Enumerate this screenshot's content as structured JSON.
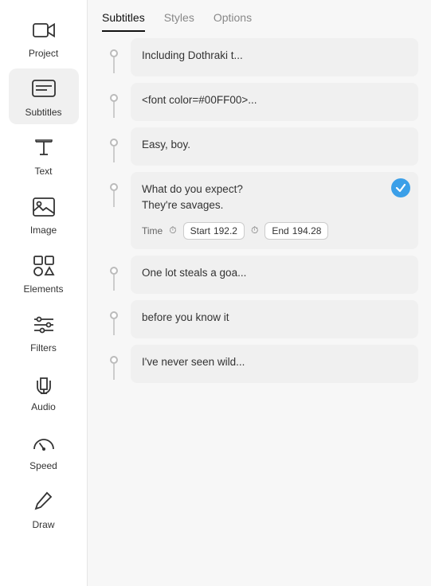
{
  "sidebar": {
    "items": [
      {
        "id": "project",
        "label": "Project",
        "icon": "video-icon"
      },
      {
        "id": "subtitles",
        "label": "Subtitles",
        "icon": "subtitles-icon",
        "active": true
      },
      {
        "id": "text",
        "label": "Text",
        "icon": "text-icon"
      },
      {
        "id": "image",
        "label": "Image",
        "icon": "image-icon"
      },
      {
        "id": "elements",
        "label": "Elements",
        "icon": "elements-icon"
      },
      {
        "id": "filters",
        "label": "Filters",
        "icon": "filters-icon"
      },
      {
        "id": "audio",
        "label": "Audio",
        "icon": "audio-icon"
      },
      {
        "id": "speed",
        "label": "Speed",
        "icon": "speed-icon"
      },
      {
        "id": "draw",
        "label": "Draw",
        "icon": "draw-icon"
      }
    ]
  },
  "tabs": [
    {
      "id": "subtitles",
      "label": "Subtitles",
      "active": true
    },
    {
      "id": "styles",
      "label": "Styles"
    },
    {
      "id": "options",
      "label": "Options"
    }
  ],
  "cards": [
    {
      "id": 1,
      "text": "Including Dothraki t..."
    },
    {
      "id": 2,
      "text": "<font color=#00FF00>..."
    },
    {
      "id": 3,
      "text": "Easy, boy."
    },
    {
      "id": 4,
      "text": "What do you expect?\nThey're savages.",
      "active": true,
      "time": {
        "label": "Time",
        "start_label": "Start",
        "start_value": "192.2",
        "end_label": "End",
        "end_value": "194.28"
      }
    },
    {
      "id": 5,
      "text": "One lot steals a goa..."
    },
    {
      "id": 6,
      "text": "before you know it"
    },
    {
      "id": 7,
      "text": "I've never seen wild..."
    }
  ]
}
